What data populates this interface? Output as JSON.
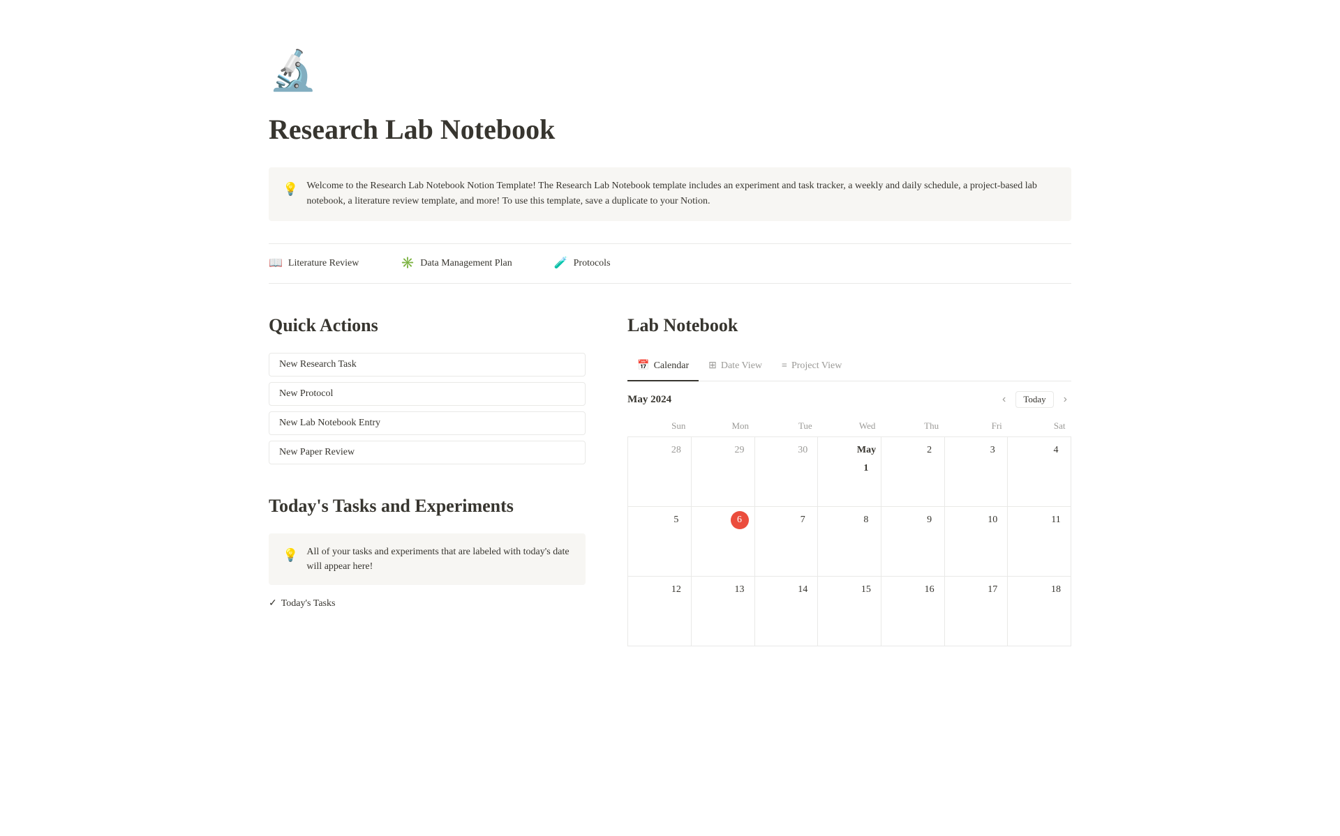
{
  "page": {
    "icon": "🔬",
    "title": "Research Lab Notebook",
    "callout": {
      "icon": "💡",
      "text": "Welcome to the Research Lab Notebook Notion Template!  The Research Lab Notebook template includes an experiment and task tracker, a weekly and daily schedule, a project-based lab notebook, a literature review template, and more! To use this template, save a duplicate to your Notion."
    }
  },
  "nav": {
    "items": [
      {
        "id": "literature-review",
        "icon": "📖",
        "label": "Literature Review"
      },
      {
        "id": "data-management",
        "icon": "✳️",
        "label": "Data Management Plan"
      },
      {
        "id": "protocols",
        "icon": "🧪",
        "label": "Protocols"
      }
    ]
  },
  "quick_actions": {
    "title": "Quick Actions",
    "buttons": [
      {
        "id": "new-research-task",
        "label": "New Research Task"
      },
      {
        "id": "new-protocol",
        "label": "New Protocol"
      },
      {
        "id": "new-lab-notebook-entry",
        "label": "New Lab Notebook Entry"
      },
      {
        "id": "new-paper-review",
        "label": "New Paper Review"
      }
    ]
  },
  "today_tasks": {
    "title": "Today's Tasks and Experiments",
    "callout_icon": "💡",
    "callout_text": "All of your tasks and experiments that are labeled with today's date will appear here!",
    "link_label": "Today's Tasks"
  },
  "lab_notebook": {
    "title": "Lab Notebook",
    "tabs": [
      {
        "id": "calendar",
        "icon": "📅",
        "label": "Calendar",
        "active": true
      },
      {
        "id": "date-view",
        "icon": "⊞",
        "label": "Date View",
        "active": false
      },
      {
        "id": "project-view",
        "icon": "≡",
        "label": "Project View",
        "active": false
      }
    ],
    "calendar": {
      "month_label": "May 2024",
      "today_button": "Today",
      "weekdays": [
        "Sun",
        "Mon",
        "Tue",
        "Wed",
        "Thu",
        "Fri",
        "Sat"
      ],
      "weeks": [
        [
          {
            "day": "28",
            "current": false
          },
          {
            "day": "29",
            "current": false
          },
          {
            "day": "30",
            "current": false
          },
          {
            "day": "May 1",
            "current": true,
            "bold": true
          },
          {
            "day": "2",
            "current": true
          },
          {
            "day": "3",
            "current": true
          },
          {
            "day": "4",
            "current": true
          }
        ],
        [
          {
            "day": "5",
            "current": true
          },
          {
            "day": "6",
            "current": true,
            "today": true
          },
          {
            "day": "7",
            "current": true
          },
          {
            "day": "8",
            "current": true
          },
          {
            "day": "9",
            "current": true
          },
          {
            "day": "10",
            "current": true
          },
          {
            "day": "11",
            "current": true
          }
        ],
        [
          {
            "day": "12",
            "current": true
          },
          {
            "day": "13",
            "current": true
          },
          {
            "day": "14",
            "current": true
          },
          {
            "day": "15",
            "current": true
          },
          {
            "day": "16",
            "current": true
          },
          {
            "day": "17",
            "current": true
          },
          {
            "day": "18",
            "current": true
          }
        ]
      ]
    }
  }
}
